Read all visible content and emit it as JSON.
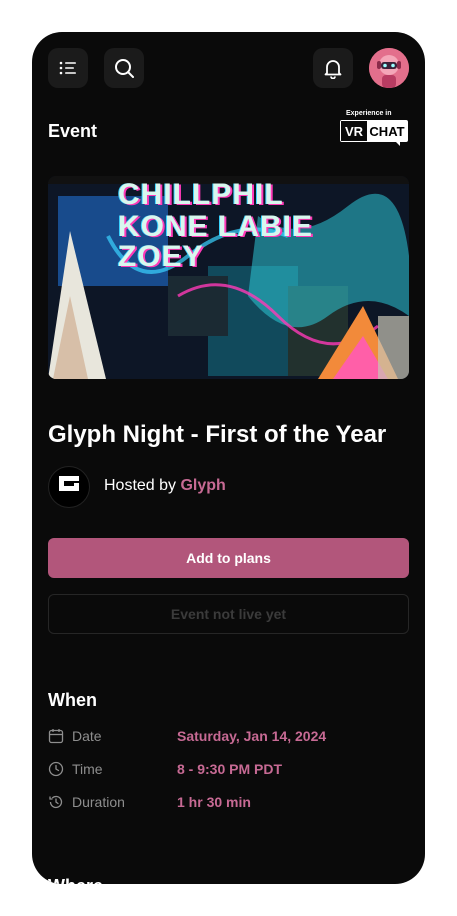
{
  "header": {
    "menu_icon": "list-menu-icon",
    "search_icon": "search-icon",
    "bell_icon": "bell-icon",
    "avatar_icon": "robot-avatar"
  },
  "section": {
    "label": "Event"
  },
  "vrchat_badge": {
    "top_text": "Experience in",
    "left_text": "VR",
    "right_text": "CHAT"
  },
  "banner": {
    "lines": [
      "CHILLPHIL",
      "KONE LABIE",
      "ZOEY"
    ],
    "alt_icon": "event-artwork-image"
  },
  "event": {
    "title": "Glyph Night - First of the Year",
    "hosted_prefix": "Hosted by ",
    "host_name": "Glyph",
    "host_logo_text": "GLYPH"
  },
  "actions": {
    "primary": "Add to plans",
    "disabled": "Event not live yet"
  },
  "when": {
    "title": "When",
    "rows": [
      {
        "label": "Date",
        "value": "Saturday, Jan 14, 2024",
        "icon": "calendar-icon"
      },
      {
        "label": "Time",
        "value": "8 - 9:30 PM PDT",
        "icon": "clock-icon"
      },
      {
        "label": "Duration",
        "value": "1 hr 30 min",
        "icon": "history-icon"
      }
    ]
  },
  "where": {
    "title": "Where"
  },
  "colors": {
    "accent": "#b2567b",
    "accent_text": "#c76a94",
    "background": "#0a0a0a"
  }
}
